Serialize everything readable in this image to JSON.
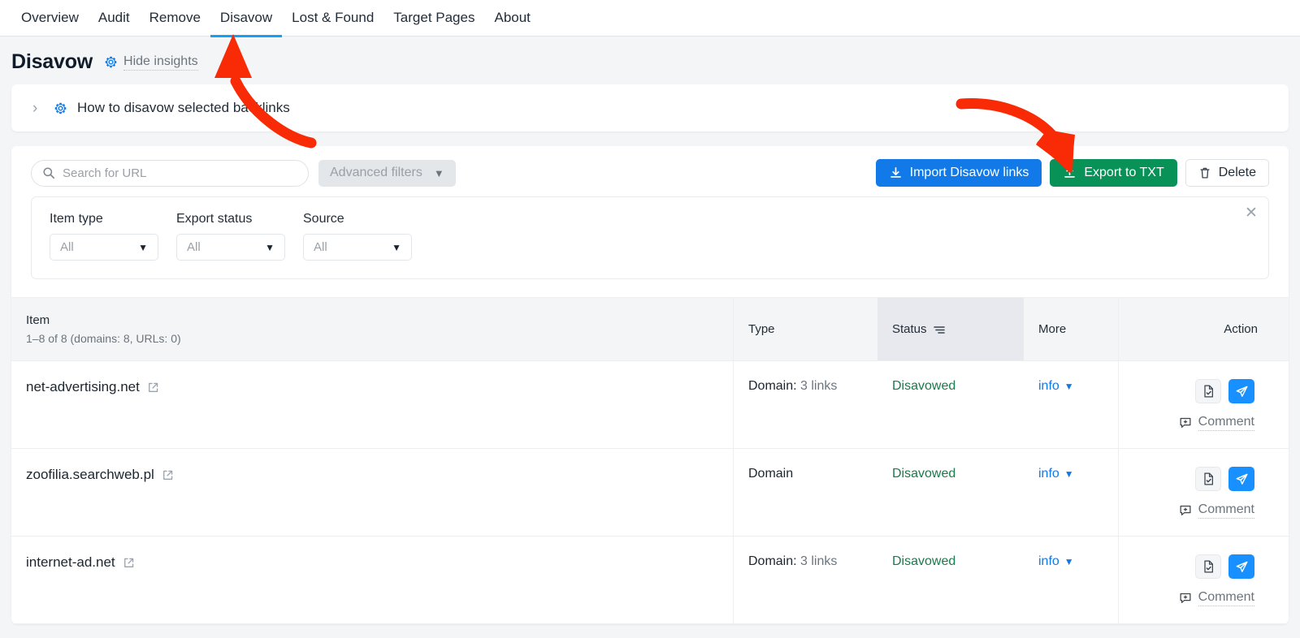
{
  "nav": {
    "items": [
      {
        "label": "Overview",
        "active": false
      },
      {
        "label": "Audit",
        "active": false
      },
      {
        "label": "Remove",
        "active": false
      },
      {
        "label": "Disavow",
        "active": true
      },
      {
        "label": "Lost & Found",
        "active": false
      },
      {
        "label": "Target Pages",
        "active": false
      },
      {
        "label": "About",
        "active": false
      }
    ]
  },
  "header": {
    "title": "Disavow",
    "insights_toggle_label": "Hide insights",
    "gear_icon": "gear-icon"
  },
  "insights": {
    "chevron_icon": "chevron-right-icon",
    "gear_icon": "gear-icon",
    "text": "How to disavow selected backlinks"
  },
  "toolbar": {
    "search": {
      "icon": "search-icon",
      "placeholder": "Search for URL",
      "value": ""
    },
    "advanced_filters_label": "Advanced filters",
    "advanced_filters_caret": "chevron-down-icon",
    "import_button": {
      "label": "Import Disavow links",
      "icon": "download-icon",
      "color": "#127ae8"
    },
    "export_button": {
      "label": "Export to TXT",
      "icon": "upload-icon",
      "color": "#089257"
    },
    "delete_button": {
      "label": "Delete",
      "icon": "trash-icon"
    }
  },
  "filters": {
    "close_icon": "close-icon",
    "fields": [
      {
        "label": "Item type",
        "value": "All",
        "caret": "chevron-down-icon"
      },
      {
        "label": "Export status",
        "value": "All",
        "caret": "chevron-down-icon"
      },
      {
        "label": "Source",
        "value": "All",
        "caret": "chevron-down-icon"
      }
    ]
  },
  "table": {
    "columns": {
      "item": "Item",
      "item_sub": "1–8 of 8 (domains: 8, URLs: 0)",
      "type": "Type",
      "status": "Status",
      "status_sort_icon": "sort-icon",
      "more": "More",
      "action": "Action"
    },
    "rows": [
      {
        "item": "net-advertising.net",
        "ext_icon": "external-link-icon",
        "type": "Domain:",
        "type_links": "3 links",
        "status": "Disavowed",
        "more": "info",
        "more_caret": "chevron-down-icon",
        "action_doc_icon": "document-check-icon",
        "action_send_icon": "send-icon",
        "comment_icon": "comment-add-icon",
        "comment_label": "Comment"
      },
      {
        "item": "zoofilia.searchweb.pl",
        "ext_icon": "external-link-icon",
        "type": "Domain",
        "type_links": "",
        "status": "Disavowed",
        "more": "info",
        "more_caret": "chevron-down-icon",
        "action_doc_icon": "document-check-icon",
        "action_send_icon": "send-icon",
        "comment_icon": "comment-add-icon",
        "comment_label": "Comment"
      },
      {
        "item": "internet-ad.net",
        "ext_icon": "external-link-icon",
        "type": "Domain:",
        "type_links": "3 links",
        "status": "Disavowed",
        "more": "info",
        "more_caret": "chevron-down-icon",
        "action_doc_icon": "document-check-icon",
        "action_send_icon": "send-icon",
        "comment_icon": "comment-add-icon",
        "comment_label": "Comment"
      }
    ]
  },
  "annotations": {
    "color": "#f92a06",
    "arrow_1_target": "disavow-tab",
    "arrow_2_target": "export-to-txt-button"
  }
}
